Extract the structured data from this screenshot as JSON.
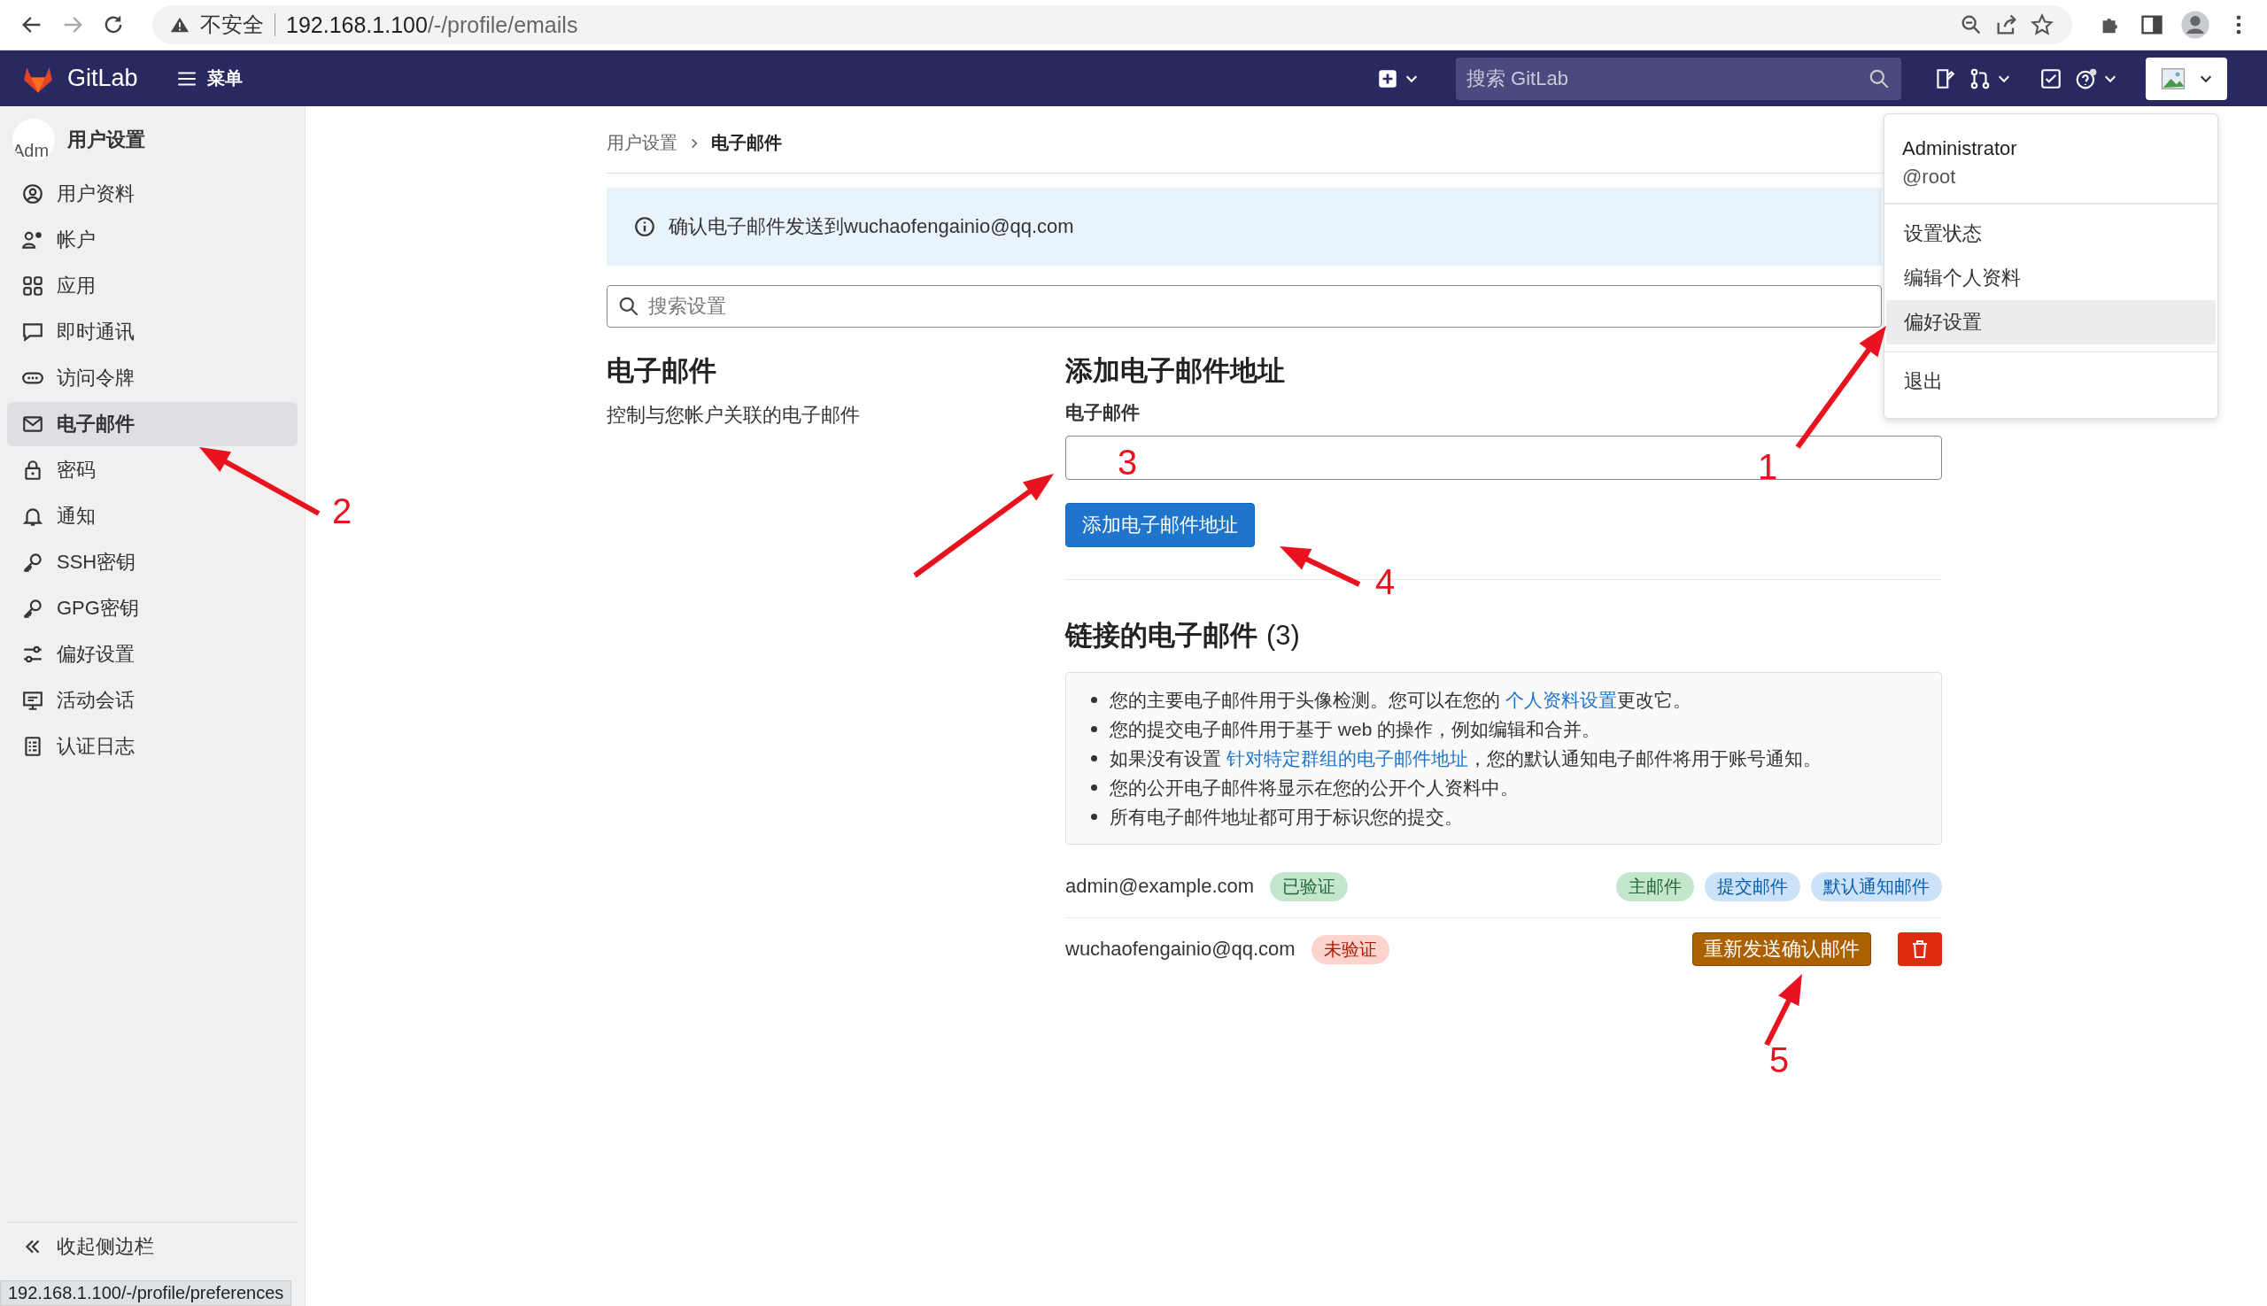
{
  "browser": {
    "security_label": "不安全",
    "url_host": "192.168.1.100",
    "url_path": "/-/profile/emails"
  },
  "topbar": {
    "brand": "GitLab",
    "menu_label": "菜单",
    "search": {
      "placeholder": "搜索 GitLab"
    }
  },
  "sidebar": {
    "title": "用户设置",
    "avatar_text": "Adm",
    "items": [
      {
        "label": "用户资料",
        "selected": false
      },
      {
        "label": "帐户",
        "selected": false
      },
      {
        "label": "应用",
        "selected": false
      },
      {
        "label": "即时通讯",
        "selected": false
      },
      {
        "label": "访问令牌",
        "selected": false
      },
      {
        "label": "电子邮件",
        "selected": true
      },
      {
        "label": "密码",
        "selected": false
      },
      {
        "label": "通知",
        "selected": false
      },
      {
        "label": "SSH密钥",
        "selected": false
      },
      {
        "label": "GPG密钥",
        "selected": false
      },
      {
        "label": "偏好设置",
        "selected": false
      },
      {
        "label": "活动会话",
        "selected": false
      },
      {
        "label": "认证日志",
        "selected": false
      }
    ],
    "collapse_label": "收起侧边栏"
  },
  "breadcrumb": [
    "用户设置",
    "电子邮件"
  ],
  "alert": {
    "text": "确认电子邮件发送到wuchaofengainio@qq.com"
  },
  "settings_search": {
    "placeholder": "搜索设置"
  },
  "section": {
    "title": "电子邮件",
    "description": "控制与您帐户关联的电子邮件"
  },
  "add_form": {
    "title": "添加电子邮件地址",
    "field_label": "电子邮件",
    "button": "添加电子邮件地址"
  },
  "linked": {
    "title": "链接的电子邮件",
    "count": "(3)",
    "notes": [
      {
        "before": "您的主要电子邮件用于头像检测。您可以在您的 ",
        "link": "个人资料设置",
        "after": "更改它。"
      },
      {
        "before": "您的提交电子邮件用于基于 web 的操作，例如编辑和合并。"
      },
      {
        "before": "如果没有设置 ",
        "link": "针对特定群组的电子邮件地址",
        "after": "，您的默认通知电子邮件将用于账号通知。"
      },
      {
        "before": "您的公开电子邮件将显示在您的公开个人资料中。"
      },
      {
        "before": "所有电子邮件地址都可用于标识您的提交。"
      }
    ]
  },
  "emails": [
    {
      "address": "admin@example.com",
      "verified": true,
      "status_label": "已验证",
      "tags": [
        {
          "label": "主邮件",
          "kind": "primary"
        },
        {
          "label": "提交邮件",
          "kind": "commit"
        },
        {
          "label": "默认通知邮件",
          "kind": "notification"
        }
      ]
    },
    {
      "address": "wuchaofengainio@qq.com",
      "verified": false,
      "status_label": "未验证",
      "resend_button": "重新发送确认邮件",
      "can_delete": true
    }
  ],
  "user_menu": {
    "name": "Administrator",
    "username": "@root",
    "groups": [
      [
        {
          "label": "设置状态",
          "selected": false
        },
        {
          "label": "编辑个人资料",
          "selected": false
        },
        {
          "label": "偏好设置",
          "selected": true
        }
      ],
      [
        {
          "label": "退出",
          "selected": false
        }
      ]
    ]
  },
  "annotations": [
    "1",
    "2",
    "3",
    "4",
    "5"
  ],
  "status_url": "192.168.1.100/-/profile/preferences"
}
